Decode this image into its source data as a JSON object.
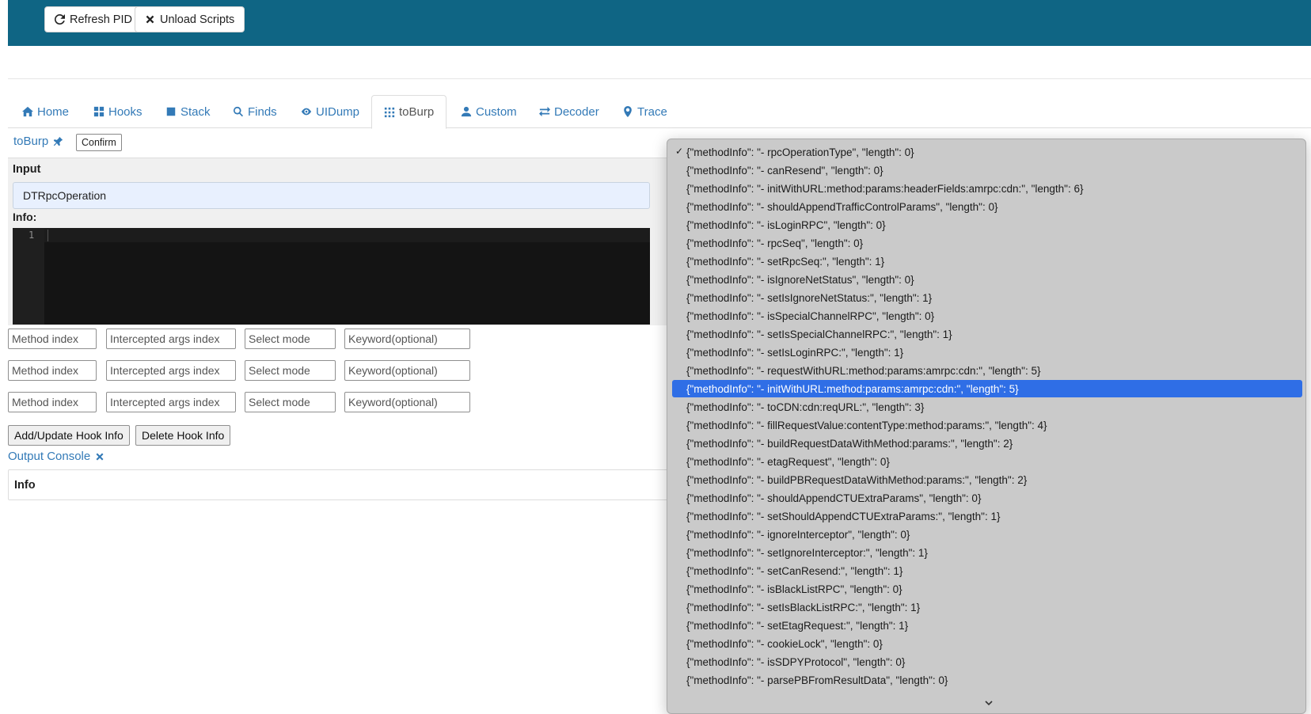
{
  "topbar": {
    "refresh_label": "Refresh PID",
    "unload_label": "Unload Scripts"
  },
  "tabs": [
    {
      "label": "Home",
      "icon": "home-icon"
    },
    {
      "label": "Hooks",
      "icon": "grid-icon"
    },
    {
      "label": "Stack",
      "icon": "stack-icon"
    },
    {
      "label": "Finds",
      "icon": "search-icon"
    },
    {
      "label": "UIDump",
      "icon": "eye-icon"
    },
    {
      "label": "toBurp",
      "icon": "apps-icon"
    },
    {
      "label": "Custom",
      "icon": "user-icon"
    },
    {
      "label": "Decoder",
      "icon": "exchange-icon"
    },
    {
      "label": "Trace",
      "icon": "map-marker-icon"
    }
  ],
  "active_tab": "toBurp",
  "toburp": {
    "link_label": "toBurp",
    "confirm_label": "Confirm",
    "input_label": "Input",
    "input_value": "DTRpcOperation",
    "info_label": "Info:",
    "line_number": "1"
  },
  "hook_rows": [
    {
      "method_placeholder": "Method index",
      "args_placeholder": "Intercepted args index",
      "mode_placeholder": "Select mode",
      "keyword_placeholder": "Keyword(optional)"
    },
    {
      "method_placeholder": "Method index",
      "args_placeholder": "Intercepted args index",
      "mode_placeholder": "Select mode",
      "keyword_placeholder": "Keyword(optional)"
    },
    {
      "method_placeholder": "Method index",
      "args_placeholder": "Intercepted args index",
      "mode_placeholder": "Select mode",
      "keyword_placeholder": "Keyword(optional)"
    }
  ],
  "actions": {
    "add_update_label": "Add/Update Hook Info",
    "delete_label": "Delete Hook Info"
  },
  "console": {
    "link_label": "Output Console",
    "info_title": "Info"
  },
  "dropdown": {
    "selected_index": 13,
    "checked_index": 0,
    "options": [
      "{\"methodInfo\": \"- rpcOperationType\", \"length\": 0}",
      "{\"methodInfo\": \"- canResend\", \"length\": 0}",
      "{\"methodInfo\": \"- initWithURL:method:params:headerFields:amrpc:cdn:\", \"length\": 6}",
      "{\"methodInfo\": \"- shouldAppendTrafficControlParams\", \"length\": 0}",
      "{\"methodInfo\": \"- isLoginRPC\", \"length\": 0}",
      "{\"methodInfo\": \"- rpcSeq\", \"length\": 0}",
      "{\"methodInfo\": \"- setRpcSeq:\", \"length\": 1}",
      "{\"methodInfo\": \"- isIgnoreNetStatus\", \"length\": 0}",
      "{\"methodInfo\": \"- setIsIgnoreNetStatus:\", \"length\": 1}",
      "{\"methodInfo\": \"- isSpecialChannelRPC\", \"length\": 0}",
      "{\"methodInfo\": \"- setIsSpecialChannelRPC:\", \"length\": 1}",
      "{\"methodInfo\": \"- setIsLoginRPC:\", \"length\": 1}",
      "{\"methodInfo\": \"- requestWithURL:method:params:amrpc:cdn:\", \"length\": 5}",
      "{\"methodInfo\": \"- initWithURL:method:params:amrpc:cdn:\", \"length\": 5}",
      "{\"methodInfo\": \"- toCDN:cdn:reqURL:\", \"length\": 3}",
      "{\"methodInfo\": \"- fillRequestValue:contentType:method:params:\", \"length\": 4}",
      "{\"methodInfo\": \"- buildRequestDataWithMethod:params:\", \"length\": 2}",
      "{\"methodInfo\": \"- etagRequest\", \"length\": 0}",
      "{\"methodInfo\": \"- buildPBRequestDataWithMethod:params:\", \"length\": 2}",
      "{\"methodInfo\": \"- shouldAppendCTUExtraParams\", \"length\": 0}",
      "{\"methodInfo\": \"- setShouldAppendCTUExtraParams:\", \"length\": 1}",
      "{\"methodInfo\": \"- ignoreInterceptor\", \"length\": 0}",
      "{\"methodInfo\": \"- setIgnoreInterceptor:\", \"length\": 1}",
      "{\"methodInfo\": \"- setCanResend:\", \"length\": 1}",
      "{\"methodInfo\": \"- isBlackListRPC\", \"length\": 0}",
      "{\"methodInfo\": \"- setIsBlackListRPC:\", \"length\": 1}",
      "{\"methodInfo\": \"- setEtagRequest:\", \"length\": 1}",
      "{\"methodInfo\": \"- cookieLock\", \"length\": 0}",
      "{\"methodInfo\": \"- isSDPYProtocol\", \"length\": 0}",
      "{\"methodInfo\": \"- parsePBFromResultData\", \"length\": 0}"
    ]
  },
  "colors": {
    "topbar": "#0f6584",
    "link": "#337ab7",
    "selection": "#2f6ee6"
  }
}
